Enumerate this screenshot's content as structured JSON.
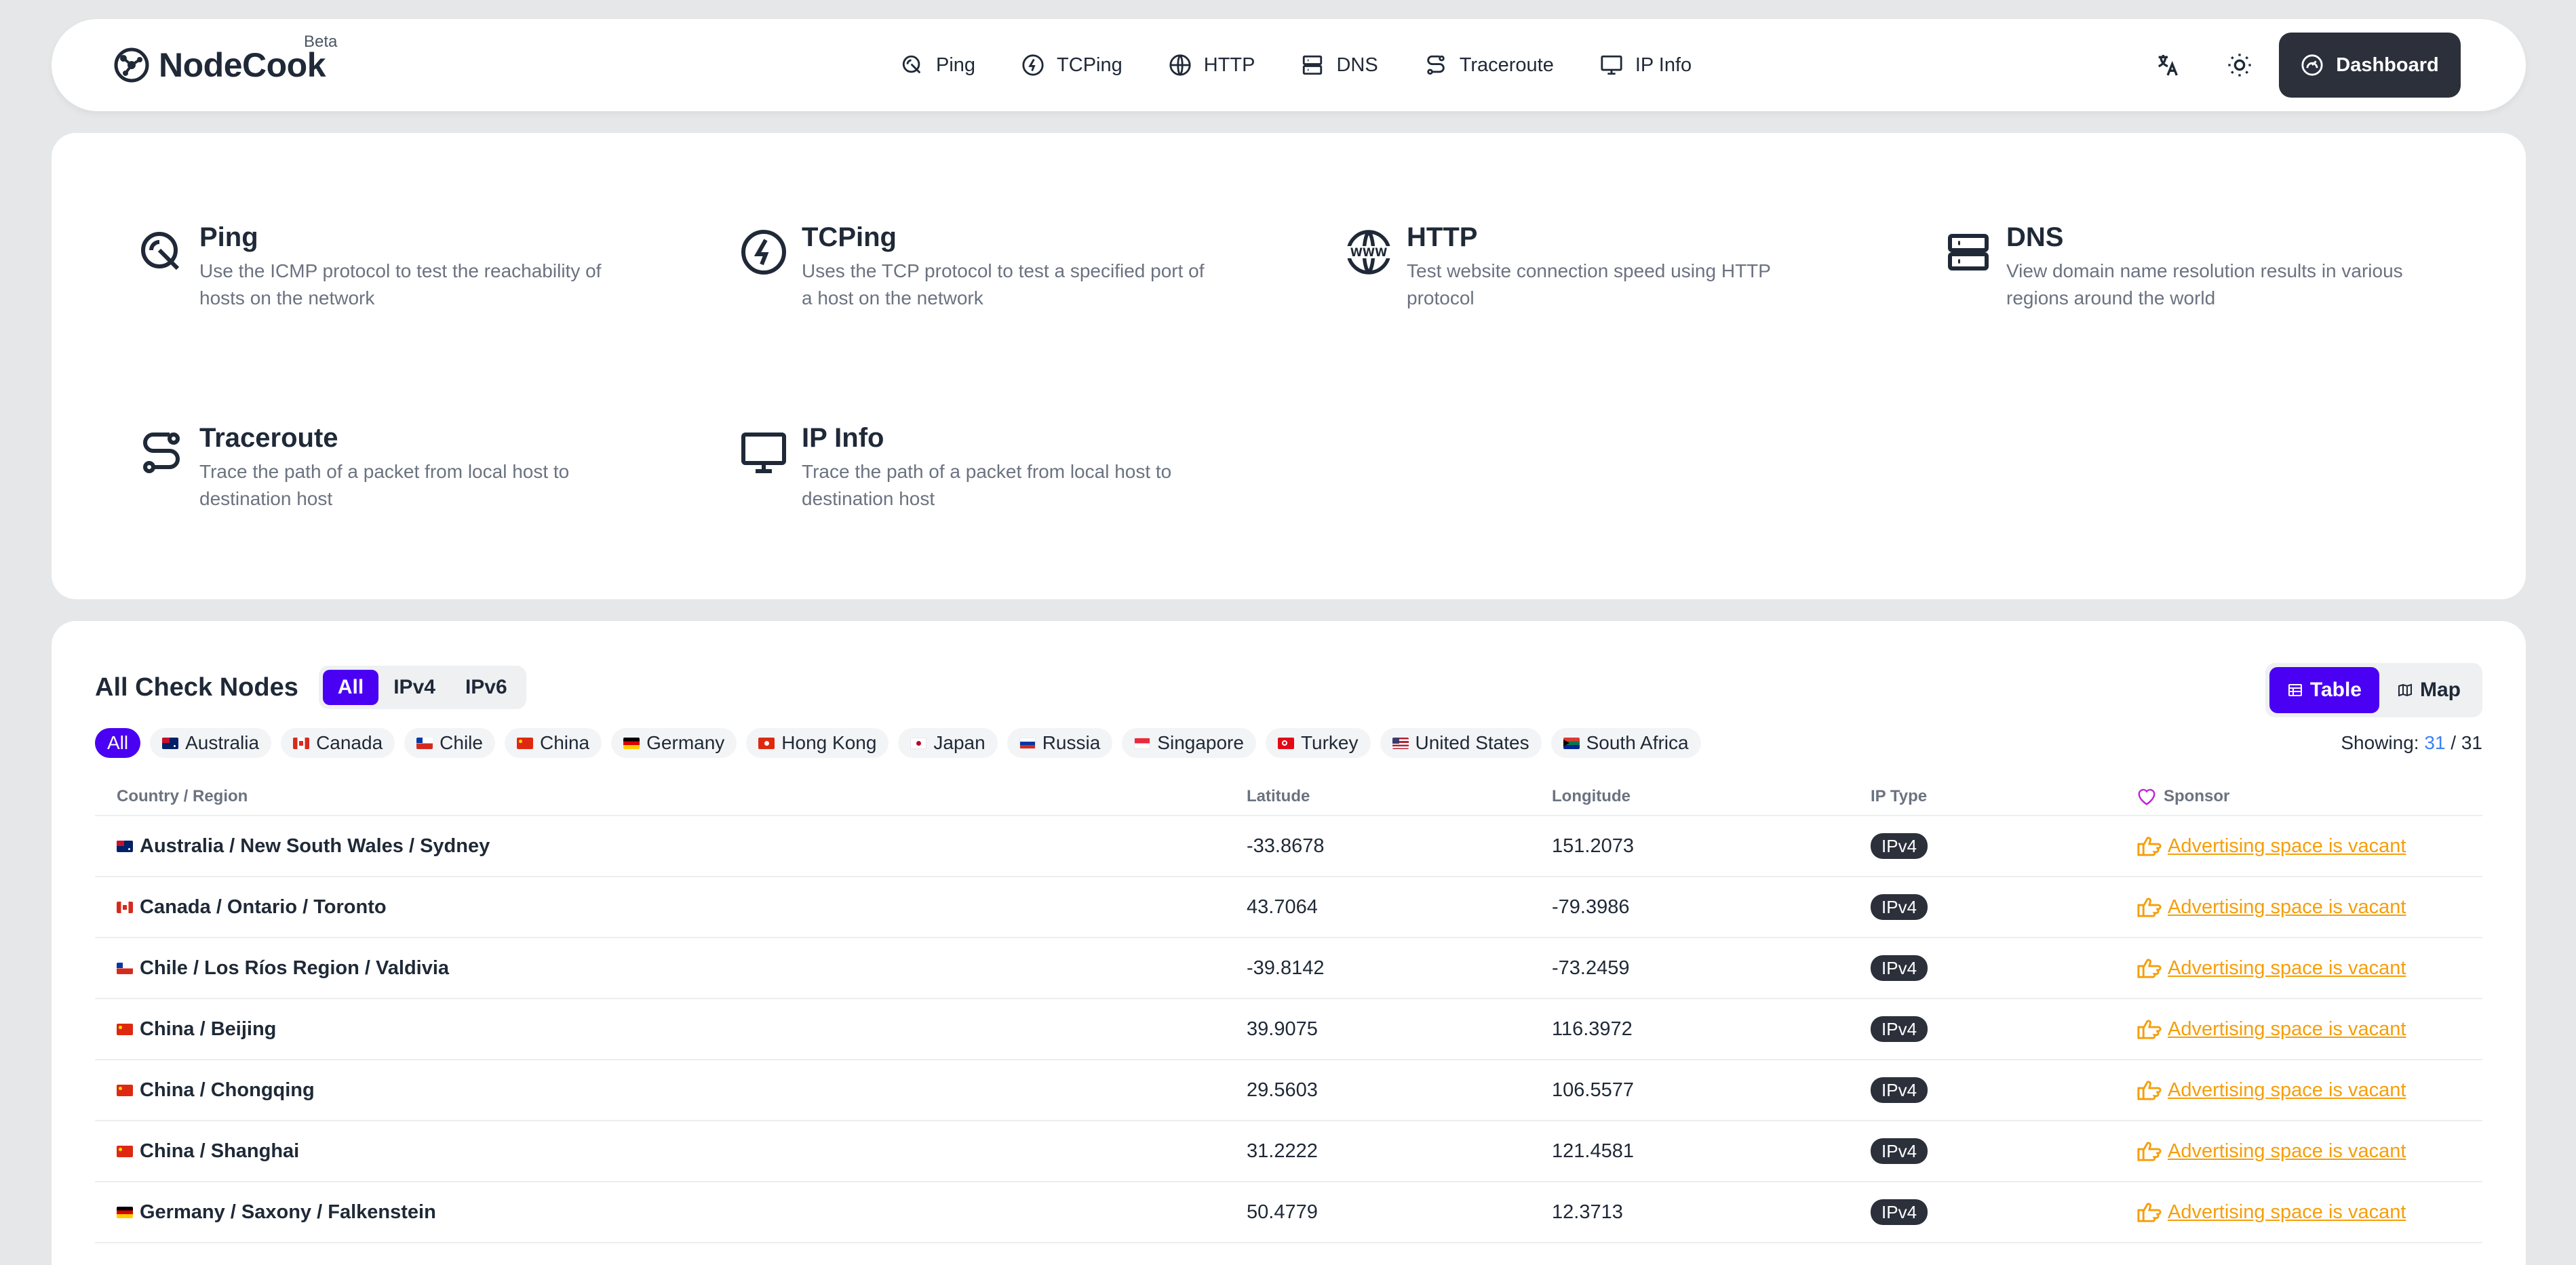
{
  "brand": {
    "name": "NodeCook",
    "beta": "Beta"
  },
  "nav": {
    "links": [
      {
        "label": "Ping",
        "icon": "ping-icon"
      },
      {
        "label": "TCPing",
        "icon": "bolt-icon"
      },
      {
        "label": "HTTP",
        "icon": "globe-icon"
      },
      {
        "label": "DNS",
        "icon": "server-icon"
      },
      {
        "label": "Traceroute",
        "icon": "route-icon"
      },
      {
        "label": "IP Info",
        "icon": "monitor-icon"
      }
    ],
    "dashboard": "Dashboard"
  },
  "tools": [
    {
      "title": "Ping",
      "desc1": "Use the ICMP protocol to test the reachability of",
      "desc2": "hosts on the network",
      "icon": "ping-icon"
    },
    {
      "title": "TCPing",
      "desc1": "Uses the TCP protocol to test a specified port of",
      "desc2": "a host on the network",
      "icon": "bolt-icon"
    },
    {
      "title": "HTTP",
      "desc1": "Test website connection speed using HTTP",
      "desc2": "protocol",
      "icon": "www-icon"
    },
    {
      "title": "DNS",
      "desc1": "View domain name resolution results in various",
      "desc2": "regions around the world",
      "icon": "server-icon"
    },
    {
      "title": "Traceroute",
      "desc1": "Trace the path of a packet from local host to",
      "desc2": "destination host",
      "icon": "route-icon"
    },
    {
      "title": "IP Info",
      "desc1": "Trace the path of a packet from local host to",
      "desc2": "destination host",
      "icon": "monitor-icon"
    }
  ],
  "nodes": {
    "title": "All Check Nodes",
    "ip_filters": [
      "All",
      "IPv4",
      "IPv6"
    ],
    "views": [
      "Table",
      "Map"
    ],
    "regions": [
      "All",
      "Australia",
      "Canada",
      "Chile",
      "China",
      "Germany",
      "Hong Kong",
      "Japan",
      "Russia",
      "Singapore",
      "Turkey",
      "United States",
      "South Africa"
    ],
    "showing_label": "Showing:",
    "showing_count": "31",
    "showing_sep": "/",
    "showing_total": "31",
    "columns": [
      "Country / Region",
      "Latitude",
      "Longitude",
      "IP Type",
      "Sponsor"
    ],
    "rows": [
      {
        "location": "Australia / New South Wales / Sydney",
        "lat": "-33.8678",
        "lon": "151.2073",
        "ip": "IPv4",
        "sponsor": "Advertising space is vacant"
      },
      {
        "location": "Canada / Ontario / Toronto",
        "lat": "43.7064",
        "lon": "-79.3986",
        "ip": "IPv4",
        "sponsor": "Advertising space is vacant"
      },
      {
        "location": "Chile / Los Ríos Region / Valdivia",
        "lat": "-39.8142",
        "lon": "-73.2459",
        "ip": "IPv4",
        "sponsor": "Advertising space is vacant"
      },
      {
        "location": "China / Beijing",
        "lat": "39.9075",
        "lon": "116.3972",
        "ip": "IPv4",
        "sponsor": "Advertising space is vacant"
      },
      {
        "location": "China / Chongqing",
        "lat": "29.5603",
        "lon": "106.5577",
        "ip": "IPv4",
        "sponsor": "Advertising space is vacant"
      },
      {
        "location": "China / Shanghai",
        "lat": "31.2222",
        "lon": "121.4581",
        "ip": "IPv4",
        "sponsor": "Advertising space is vacant"
      },
      {
        "location": "Germany / Saxony / Falkenstein",
        "lat": "50.4779",
        "lon": "12.3713",
        "ip": "IPv4",
        "sponsor": "Advertising space is vacant"
      }
    ]
  },
  "colors": {
    "accent": "#4a00f2",
    "dark": "#2b303b",
    "sponsor": "#f59e0b",
    "link": "#3b82f6"
  }
}
